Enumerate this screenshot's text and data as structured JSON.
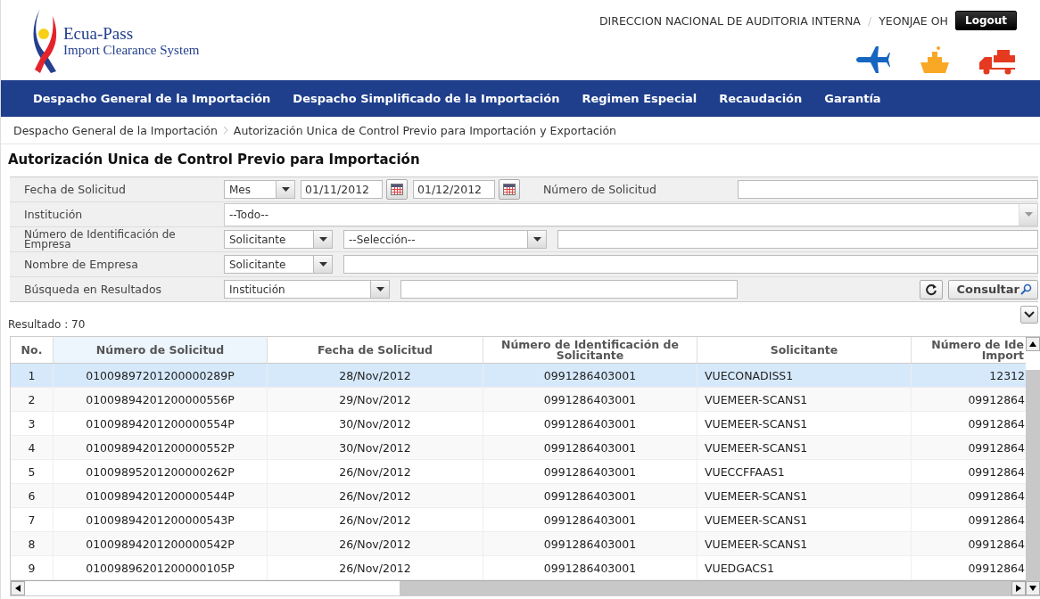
{
  "header": {
    "logo_title": "Ecua-Pass",
    "logo_subtitle": "Import Clearance System",
    "organization": "DIRECCION NACIONAL DE AUDITORIA INTERNA",
    "separator": "/",
    "user": "YEONJAE OH",
    "logout": "Logout"
  },
  "nav": [
    "Despacho General de la Importación",
    "Despacho Simplificado de la Importación",
    "Regimen Especial",
    "Recaudación",
    "Garantía"
  ],
  "breadcrumb": [
    "Despacho General de la Importación",
    "Autorización Unica de Control Previo para Importación y Exportación"
  ],
  "page_title": "Autorización Unica de Control Previo para Importación",
  "filters": {
    "fecha": {
      "label": "Fecha de Solicitud",
      "period": "Mes",
      "from": "01/11/2012",
      "to": "01/12/2012"
    },
    "numero": {
      "label": "Número de Solicitud"
    },
    "institucion": {
      "label": "Institución",
      "value": "--Todo--"
    },
    "id_empresa": {
      "label": "Número de Identificación de Empresa",
      "party": "Solicitante",
      "selection": "--Selección--"
    },
    "nombre_empresa": {
      "label": "Nombre de Empresa",
      "party": "Solicitante"
    },
    "busqueda": {
      "label": "Búsqueda en Resultados",
      "field": "Institución"
    },
    "consultar": "Consultar"
  },
  "result_count": "Resultado : 70",
  "table": {
    "columns": [
      {
        "label": "No.",
        "selected": false
      },
      {
        "label": "Número de Solicitud",
        "selected": true
      },
      {
        "label": "Fecha de Solicitud",
        "selected": false
      },
      {
        "label": "Número de Identificación de Solicitante",
        "selected": false
      },
      {
        "label": "Solicitante",
        "selected": false
      },
      {
        "label": "Número de Ide\nImport",
        "selected": false
      }
    ],
    "rows": [
      {
        "selected": true,
        "cells": [
          "1",
          "01009897201200000289P",
          "28/Nov/2012",
          "0991286403001",
          "VUECONADISS1",
          "12312"
        ]
      },
      {
        "selected": false,
        "cells": [
          "2",
          "01009894201200000556P",
          "29/Nov/2012",
          "0991286403001",
          "VUEMEER-SCANS1",
          "09912864"
        ]
      },
      {
        "selected": false,
        "cells": [
          "3",
          "01009894201200000554P",
          "30/Nov/2012",
          "0991286403001",
          "VUEMEER-SCANS1",
          "09912864"
        ]
      },
      {
        "selected": false,
        "cells": [
          "4",
          "01009894201200000552P",
          "30/Nov/2012",
          "0991286403001",
          "VUEMEER-SCANS1",
          "09912864"
        ]
      },
      {
        "selected": false,
        "cells": [
          "5",
          "01009895201200000262P",
          "26/Nov/2012",
          "0991286403001",
          "VUECCFFAAS1",
          "09912864"
        ]
      },
      {
        "selected": false,
        "cells": [
          "6",
          "01009894201200000544P",
          "26/Nov/2012",
          "0991286403001",
          "VUEMEER-SCANS1",
          "09912864"
        ]
      },
      {
        "selected": false,
        "cells": [
          "7",
          "01009894201200000543P",
          "26/Nov/2012",
          "0991286403001",
          "VUEMEER-SCANS1",
          "09912864"
        ]
      },
      {
        "selected": false,
        "cells": [
          "8",
          "01009894201200000542P",
          "26/Nov/2012",
          "0991286403001",
          "VUEMEER-SCANS1",
          "09912864"
        ]
      },
      {
        "selected": false,
        "cells": [
          "9",
          "01009896201200000105P",
          "26/Nov/2012",
          "0991286403001",
          "VUEDGACS1",
          "09912864"
        ]
      }
    ]
  }
}
